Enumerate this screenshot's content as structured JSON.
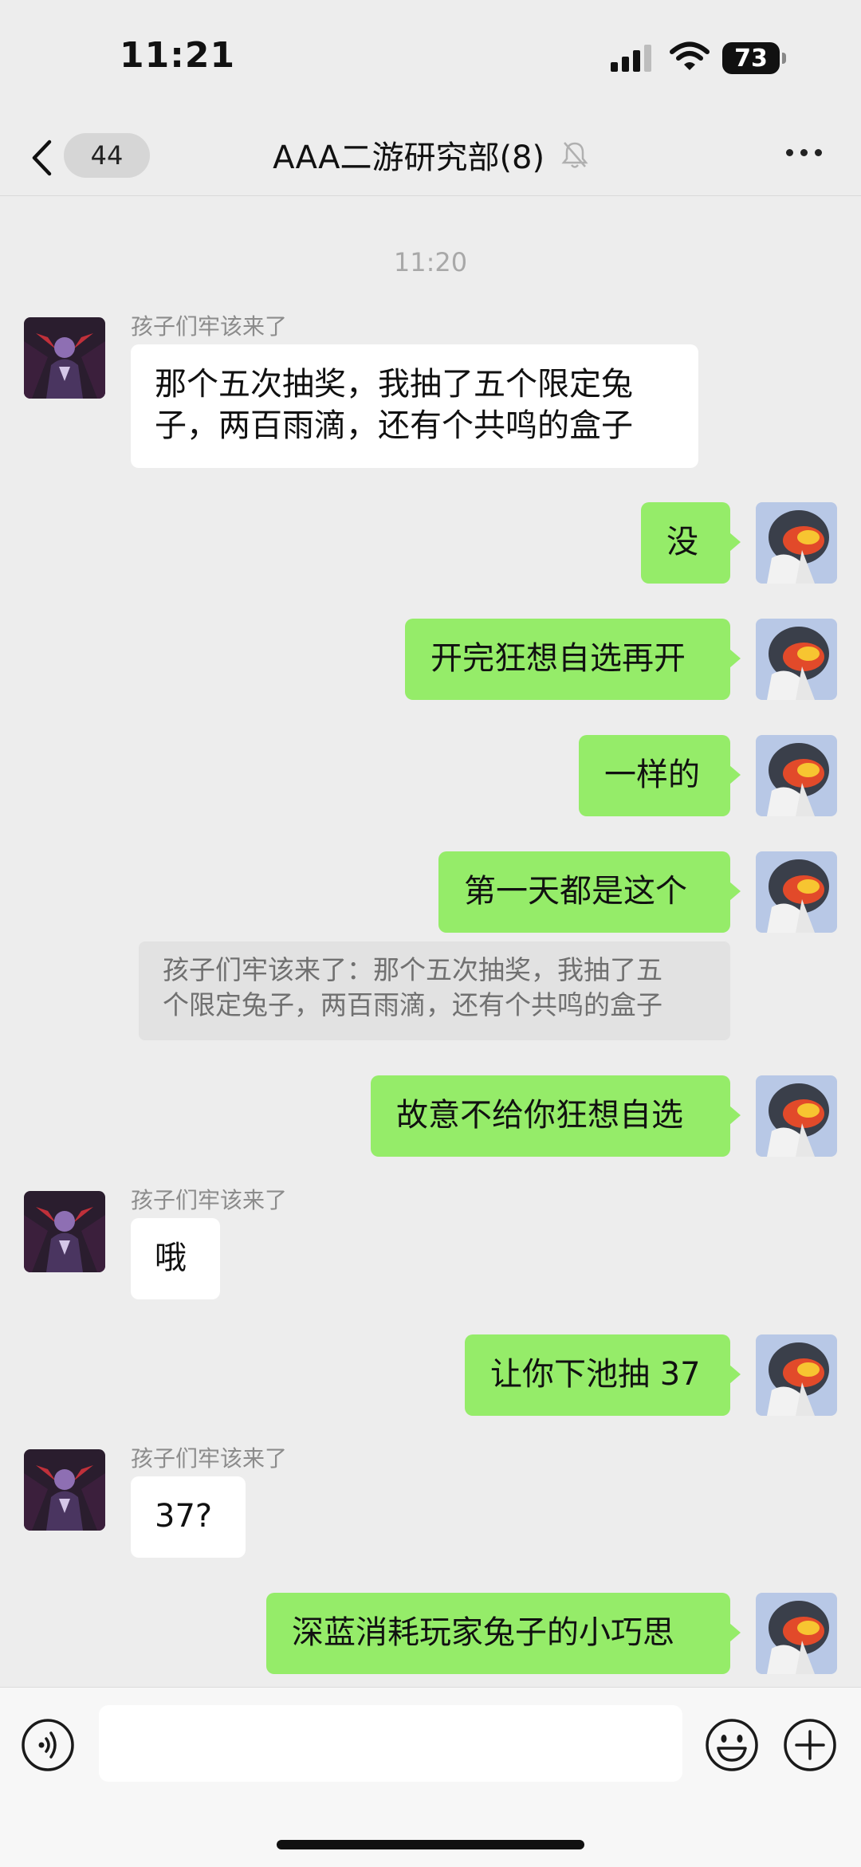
{
  "status_bar": {
    "time": "11:21",
    "battery": "73"
  },
  "header": {
    "unread_count": "44",
    "title": "AAA二游研究部(8)"
  },
  "chat": {
    "timestamp": "11:20",
    "messages": [
      {
        "sender": "孩子们牢该来了",
        "text_lines": [
          "那个五次抽奖，我抽了五个限定兔",
          "子，两百雨滴，还有个共鸣的盒子"
        ]
      },
      {
        "text": "没"
      },
      {
        "text": "开完狂想自选再开"
      },
      {
        "text": "一样的"
      },
      {
        "text": "第一天都是这个"
      },
      {
        "quote_lines": [
          "孩子们牢该来了：那个五次抽奖，我抽了五",
          "个限定兔子，两百雨滴，还有个共鸣的盒子"
        ]
      },
      {
        "text": "故意不给你狂想自选"
      },
      {
        "sender": "孩子们牢该来了",
        "text": "哦"
      },
      {
        "text": "让你下池抽 37"
      },
      {
        "sender": "孩子们牢该来了",
        "text": "37?"
      },
      {
        "text": "深蓝消耗玩家兔子的小巧思"
      }
    ]
  },
  "input_bar": {
    "placeholder": ""
  }
}
